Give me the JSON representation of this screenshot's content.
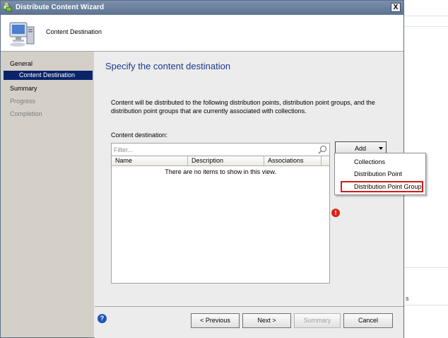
{
  "window": {
    "title": "Distribute Content Wizard",
    "close_label": "X"
  },
  "header": {
    "title": "Content Destination"
  },
  "sidebar": {
    "items": [
      {
        "label": "General"
      },
      {
        "label": "Content Destination"
      },
      {
        "label": "Summary"
      },
      {
        "label": "Progress"
      },
      {
        "label": "Completion"
      }
    ]
  },
  "main": {
    "page_title": "Specify the content destination",
    "description": "Content will be distributed to the following distribution points, distribution point groups, and the distribution point groups that are currently associated with collections.",
    "destination_label": "Content destination:",
    "filter_placeholder": "Filter...",
    "columns": [
      "Name",
      "Description",
      "Associations"
    ],
    "empty_text": "There are no items to show in this view.",
    "add_label": "Add",
    "error_glyph": "!"
  },
  "add_menu": {
    "items": [
      {
        "label": "Collections"
      },
      {
        "label": "Distribution Point"
      },
      {
        "label": "Distribution Point Group"
      }
    ]
  },
  "footer": {
    "help_glyph": "?",
    "previous": "< Previous",
    "next": "Next >",
    "summary": "Summary",
    "cancel": "Cancel"
  },
  "background": {
    "fragment_s": "s"
  },
  "colors": {
    "title_bar": "#5d7391",
    "selection": "#0a246a",
    "heading": "#1b3a8c",
    "highlight_box": "#d21a1a"
  }
}
